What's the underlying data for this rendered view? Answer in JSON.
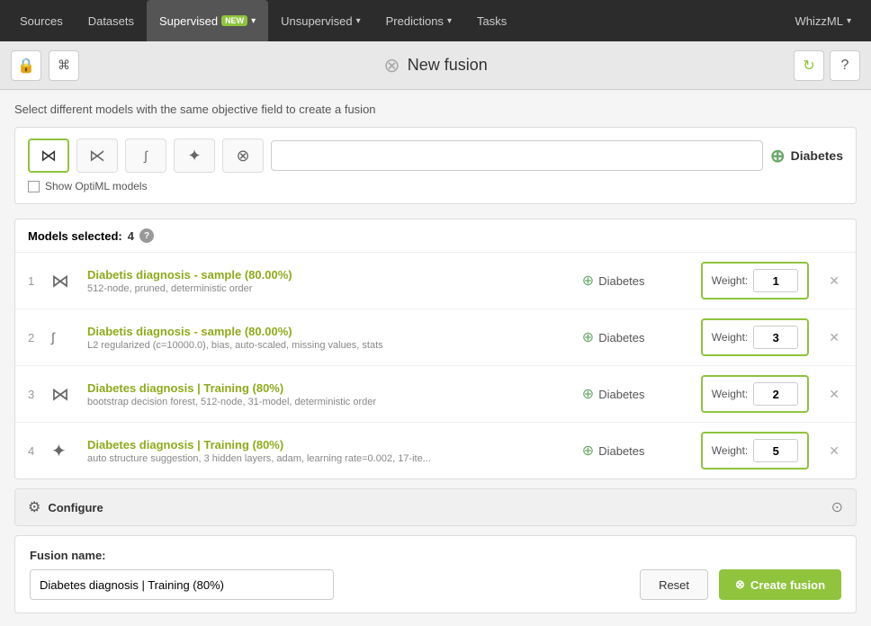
{
  "nav": {
    "items": [
      {
        "label": "Sources",
        "active": false,
        "hasDropdown": false
      },
      {
        "label": "Datasets",
        "active": false,
        "hasDropdown": false
      },
      {
        "label": "Supervised",
        "active": true,
        "hasDropdown": true,
        "badge": "NEW"
      },
      {
        "label": "Unsupervised",
        "active": false,
        "hasDropdown": true
      },
      {
        "label": "Predictions",
        "active": false,
        "hasDropdown": true
      },
      {
        "label": "Tasks",
        "active": false,
        "hasDropdown": false
      }
    ],
    "user": "WhizzML"
  },
  "toolbar": {
    "title": "New fusion"
  },
  "instruction": "Select different models with the same objective field to create a fusion",
  "search": {
    "placeholder": ""
  },
  "target": {
    "label": "Diabetes"
  },
  "show_optiml": "Show OptiML models",
  "models_section": {
    "header": "Models selected:",
    "count": "4",
    "rows": [
      {
        "num": "1",
        "name": "Diabetis diagnosis - sample (80.00%)",
        "desc": "512-node, pruned, deterministic order",
        "target": "Diabetes",
        "weight": "1",
        "type": "ensemble"
      },
      {
        "num": "2",
        "name": "Diabetis diagnosis - sample (80.00%)",
        "desc": "L2 regularized (c=10000.0), bias, auto-scaled, missing values, stats",
        "target": "Diabetes",
        "weight": "3",
        "type": "logistic"
      },
      {
        "num": "3",
        "name": "Diabetes diagnosis | Training (80%)",
        "desc": "bootstrap decision forest, 512-node, 31-model, deterministic order",
        "target": "Diabetes",
        "weight": "2",
        "type": "ensemble"
      },
      {
        "num": "4",
        "name": "Diabetes diagnosis | Training (80%)",
        "desc": "auto structure suggestion, 3 hidden layers, adam, learning rate=0.002, 17-ite...",
        "target": "Diabetes",
        "weight": "5",
        "type": "deepnet"
      }
    ]
  },
  "configure": {
    "label": "Configure"
  },
  "fusion_name": {
    "label": "Fusion name:",
    "value": "Diabetes diagnosis | Training (80%)"
  },
  "buttons": {
    "reset": "Reset",
    "create": "Create fusion"
  }
}
